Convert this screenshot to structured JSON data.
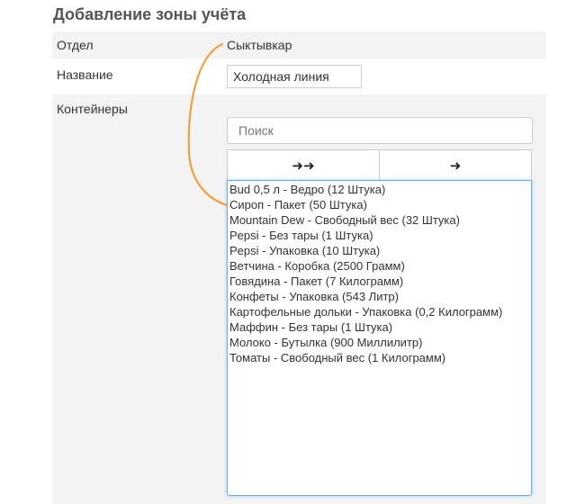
{
  "page": {
    "title": "Добавление зоны учёта"
  },
  "form": {
    "department": {
      "label": "Отдел",
      "value": "Сыктывкар"
    },
    "name": {
      "label": "Название",
      "value": "Холодная линия"
    },
    "containers": {
      "label": "Контейнеры",
      "search_placeholder": "Поиск",
      "move_all_label": "➜➜",
      "move_selected_label": "➜",
      "items": [
        "Bud 0,5 л - Ведро (12 Штука)",
        "Сироп - Пакет (50 Штука)",
        "Mountain Dew - Свободный вес (32 Штука)",
        "Pepsi - Без тары (1 Штука)",
        "Pepsi - Упаковка (10 Штука)",
        "Ветчина - Коробка (2500 Грамм)",
        "Говядина - Пакет (7 Килограмм)",
        "Конфеты - Упаковка (543 Литр)",
        "Картофельные дольки - Упаковка (0,2 Килограмм)",
        "Маффин - Без тары (1 Штука)",
        "Молоко - Бутылка (900 Миллилитр)",
        "Томаты - Свободный вес (1 Килограмм)"
      ]
    }
  },
  "colors": {
    "annotation_line": "#f39a2a",
    "focus_border": "#66afe9",
    "row_stripe": "#f3f3f3"
  }
}
